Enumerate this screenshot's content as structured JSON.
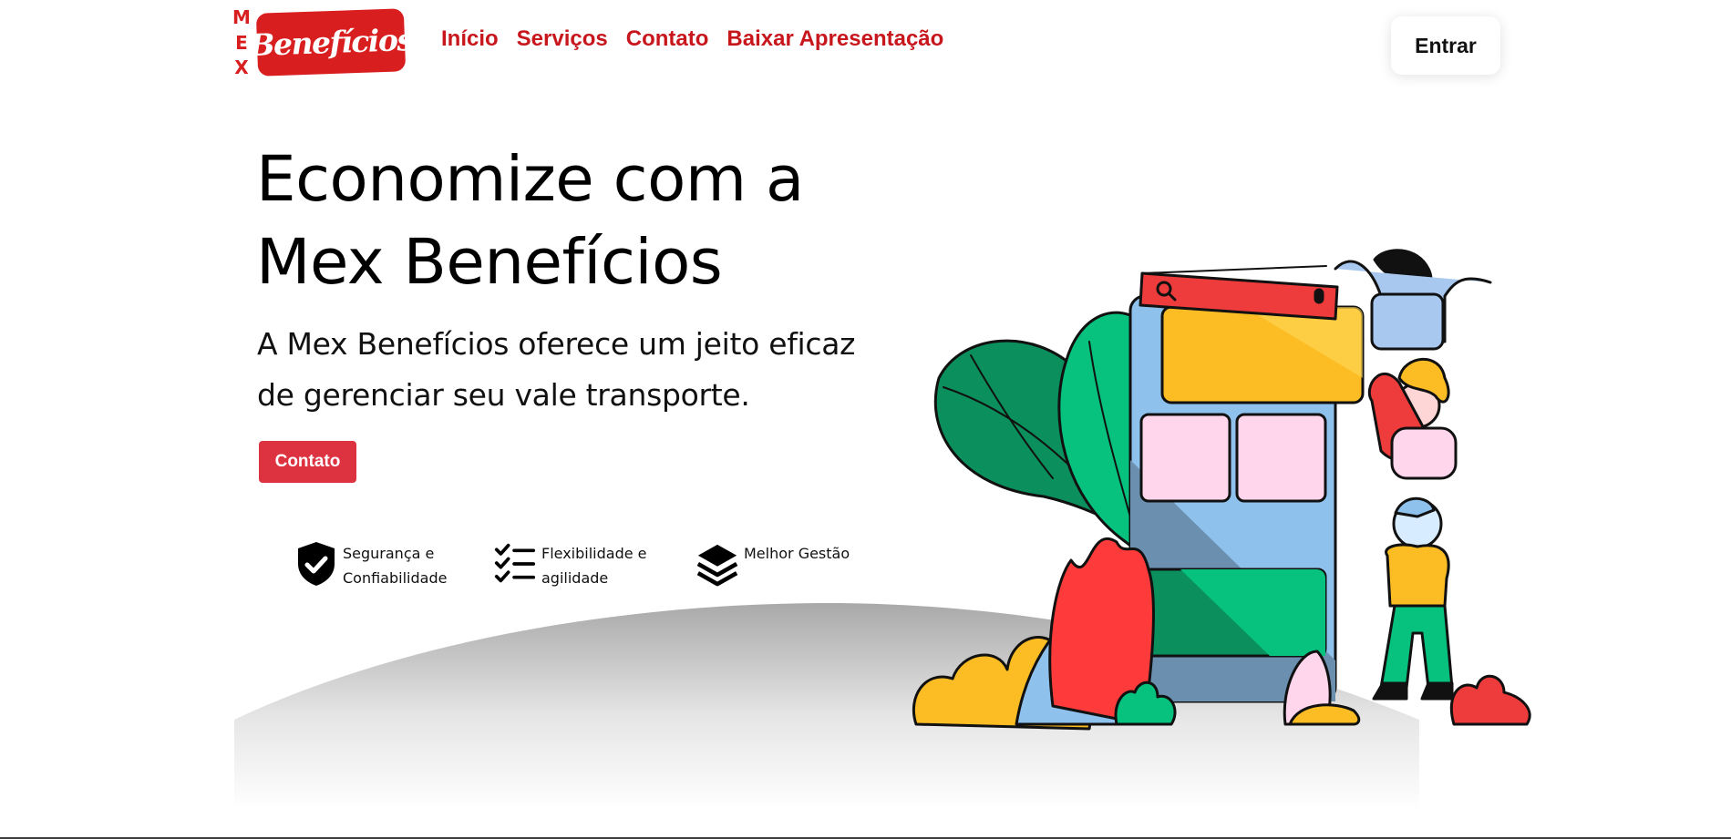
{
  "header": {
    "logo": {
      "letters": [
        "M",
        "E",
        "X"
      ],
      "wordmark": "Benefícios"
    },
    "nav": [
      {
        "label": "Início"
      },
      {
        "label": "Serviços"
      },
      {
        "label": "Contato"
      },
      {
        "label": "Baixar Apresentação"
      }
    ],
    "login_label": "Entrar"
  },
  "hero": {
    "title": "Economize com a Mex Benefícios",
    "subtitle": "A Mex Benefícios oferece um jeito eficaz de gerenciar seu vale transporte.",
    "cta_label": "Contato"
  },
  "features": [
    {
      "label": "Segurança e Confiabilidade",
      "icon": "shield-check-icon"
    },
    {
      "label": "Flexibilidade e agilidade",
      "icon": "checklist-icon"
    },
    {
      "label": "Melhor Gestão",
      "icon": "layers-icon"
    }
  ],
  "colors": {
    "brand_red": "#d81e1e",
    "nav_red": "#c8161d",
    "button_red": "#dd3341",
    "leaf_green": "#07c17f",
    "card_yellow": "#fbbd23",
    "phone_blue": "#8ec1ec",
    "card_pink": "#ffd6ec"
  }
}
